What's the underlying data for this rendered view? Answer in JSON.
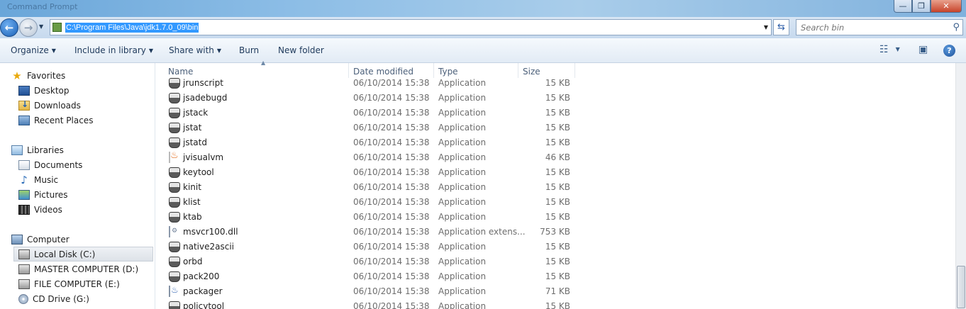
{
  "window": {
    "title": "Command Prompt",
    "controls": {
      "minimize": "—",
      "maximize": "❐",
      "close": "✕"
    }
  },
  "address": {
    "path": "C:\\Program Files\\Java\\jdk1.7.0_09\\bin",
    "search_placeholder": "Search bin"
  },
  "toolbar": {
    "organize": "Organize",
    "include_in_library": "Include in library",
    "share_with": "Share with",
    "burn": "Burn",
    "new_folder": "New folder",
    "help": "?"
  },
  "nav": {
    "favorites": "Favorites",
    "desktop": "Desktop",
    "downloads": "Downloads",
    "recent_places": "Recent Places",
    "libraries": "Libraries",
    "documents": "Documents",
    "music": "Music",
    "pictures": "Pictures",
    "videos": "Videos",
    "computer": "Computer",
    "local_disk": "Local Disk (C:)",
    "master_computer": "MASTER COMPUTER (D:)",
    "file_computer": "FILE COMPUTER (E:)",
    "cd_drive": "CD Drive (G:)"
  },
  "columns": {
    "name": "Name",
    "date": "Date modified",
    "type": "Type",
    "size": "Size"
  },
  "files": [
    {
      "name": "jrunscript",
      "date": "06/10/2014 15:38",
      "type": "Application",
      "size": "15 KB",
      "icon": "app"
    },
    {
      "name": "jsadebugd",
      "date": "06/10/2014 15:38",
      "type": "Application",
      "size": "15 KB",
      "icon": "app"
    },
    {
      "name": "jstack",
      "date": "06/10/2014 15:38",
      "type": "Application",
      "size": "15 KB",
      "icon": "app"
    },
    {
      "name": "jstat",
      "date": "06/10/2014 15:38",
      "type": "Application",
      "size": "15 KB",
      "icon": "app"
    },
    {
      "name": "jstatd",
      "date": "06/10/2014 15:38",
      "type": "Application",
      "size": "15 KB",
      "icon": "app"
    },
    {
      "name": "jvisualvm",
      "date": "06/10/2014 15:38",
      "type": "Application",
      "size": "46 KB",
      "icon": "java"
    },
    {
      "name": "keytool",
      "date": "06/10/2014 15:38",
      "type": "Application",
      "size": "15 KB",
      "icon": "app"
    },
    {
      "name": "kinit",
      "date": "06/10/2014 15:38",
      "type": "Application",
      "size": "15 KB",
      "icon": "app"
    },
    {
      "name": "klist",
      "date": "06/10/2014 15:38",
      "type": "Application",
      "size": "15 KB",
      "icon": "app"
    },
    {
      "name": "ktab",
      "date": "06/10/2014 15:38",
      "type": "Application",
      "size": "15 KB",
      "icon": "app"
    },
    {
      "name": "msvcr100.dll",
      "date": "06/10/2014 15:38",
      "type": "Application extens...",
      "size": "753 KB",
      "icon": "dll"
    },
    {
      "name": "native2ascii",
      "date": "06/10/2014 15:38",
      "type": "Application",
      "size": "15 KB",
      "icon": "app"
    },
    {
      "name": "orbd",
      "date": "06/10/2014 15:38",
      "type": "Application",
      "size": "15 KB",
      "icon": "app"
    },
    {
      "name": "pack200",
      "date": "06/10/2014 15:38",
      "type": "Application",
      "size": "15 KB",
      "icon": "app"
    },
    {
      "name": "packager",
      "date": "06/10/2014 15:38",
      "type": "Application",
      "size": "71 KB",
      "icon": "pkg"
    },
    {
      "name": "policytool",
      "date": "06/10/2014 15:38",
      "type": "Application",
      "size": "15 KB",
      "icon": "app"
    }
  ]
}
